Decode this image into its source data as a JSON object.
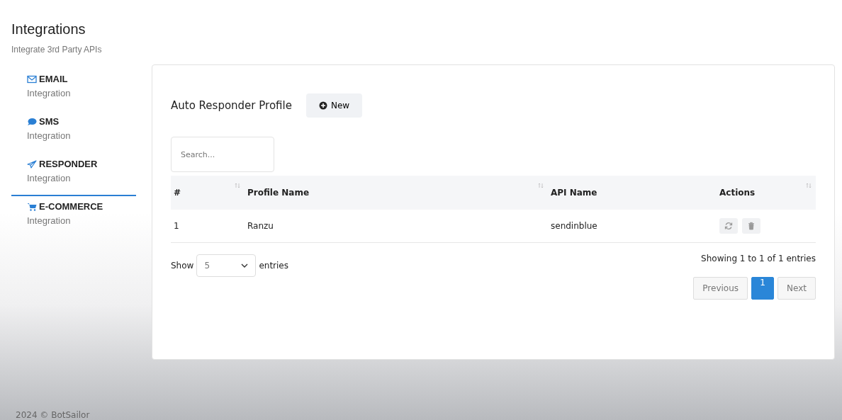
{
  "header": {
    "title": "Integrations",
    "subtitle": "Integrate 3rd Party APIs"
  },
  "sidebar": {
    "items": [
      {
        "kind": "email",
        "label": "EMAIL",
        "sublabel": "Integration",
        "selected": false
      },
      {
        "kind": "sms",
        "label": "SMS",
        "sublabel": "Integration",
        "selected": false
      },
      {
        "kind": "responder",
        "label": "RESPONDER",
        "sublabel": "Integration",
        "selected": true
      },
      {
        "kind": "ecommerce",
        "label": "E-COMMERCE",
        "sublabel": "Integration",
        "selected": false
      }
    ]
  },
  "card": {
    "title": "Auto Responder Profile",
    "new_button": "New",
    "search": {
      "placeholder": "Search..."
    },
    "table": {
      "columns": [
        "#",
        "Profile Name",
        "API Name",
        "Actions"
      ],
      "rows": [
        {
          "cells": [
            "1",
            "Ranzu",
            "sendinblue"
          ]
        }
      ]
    },
    "length": {
      "prefix": "Show",
      "value": "5",
      "suffix": "entries"
    },
    "info": "Showing 1 to 1 of 1 entries",
    "pagination": [
      {
        "label": "Previous",
        "kind": "nav",
        "selected": false
      },
      {
        "label": "1",
        "kind": "page",
        "selected": true
      },
      {
        "label": "Next",
        "kind": "nav",
        "selected": false
      }
    ]
  },
  "footer": "2024 © BotSailor"
}
